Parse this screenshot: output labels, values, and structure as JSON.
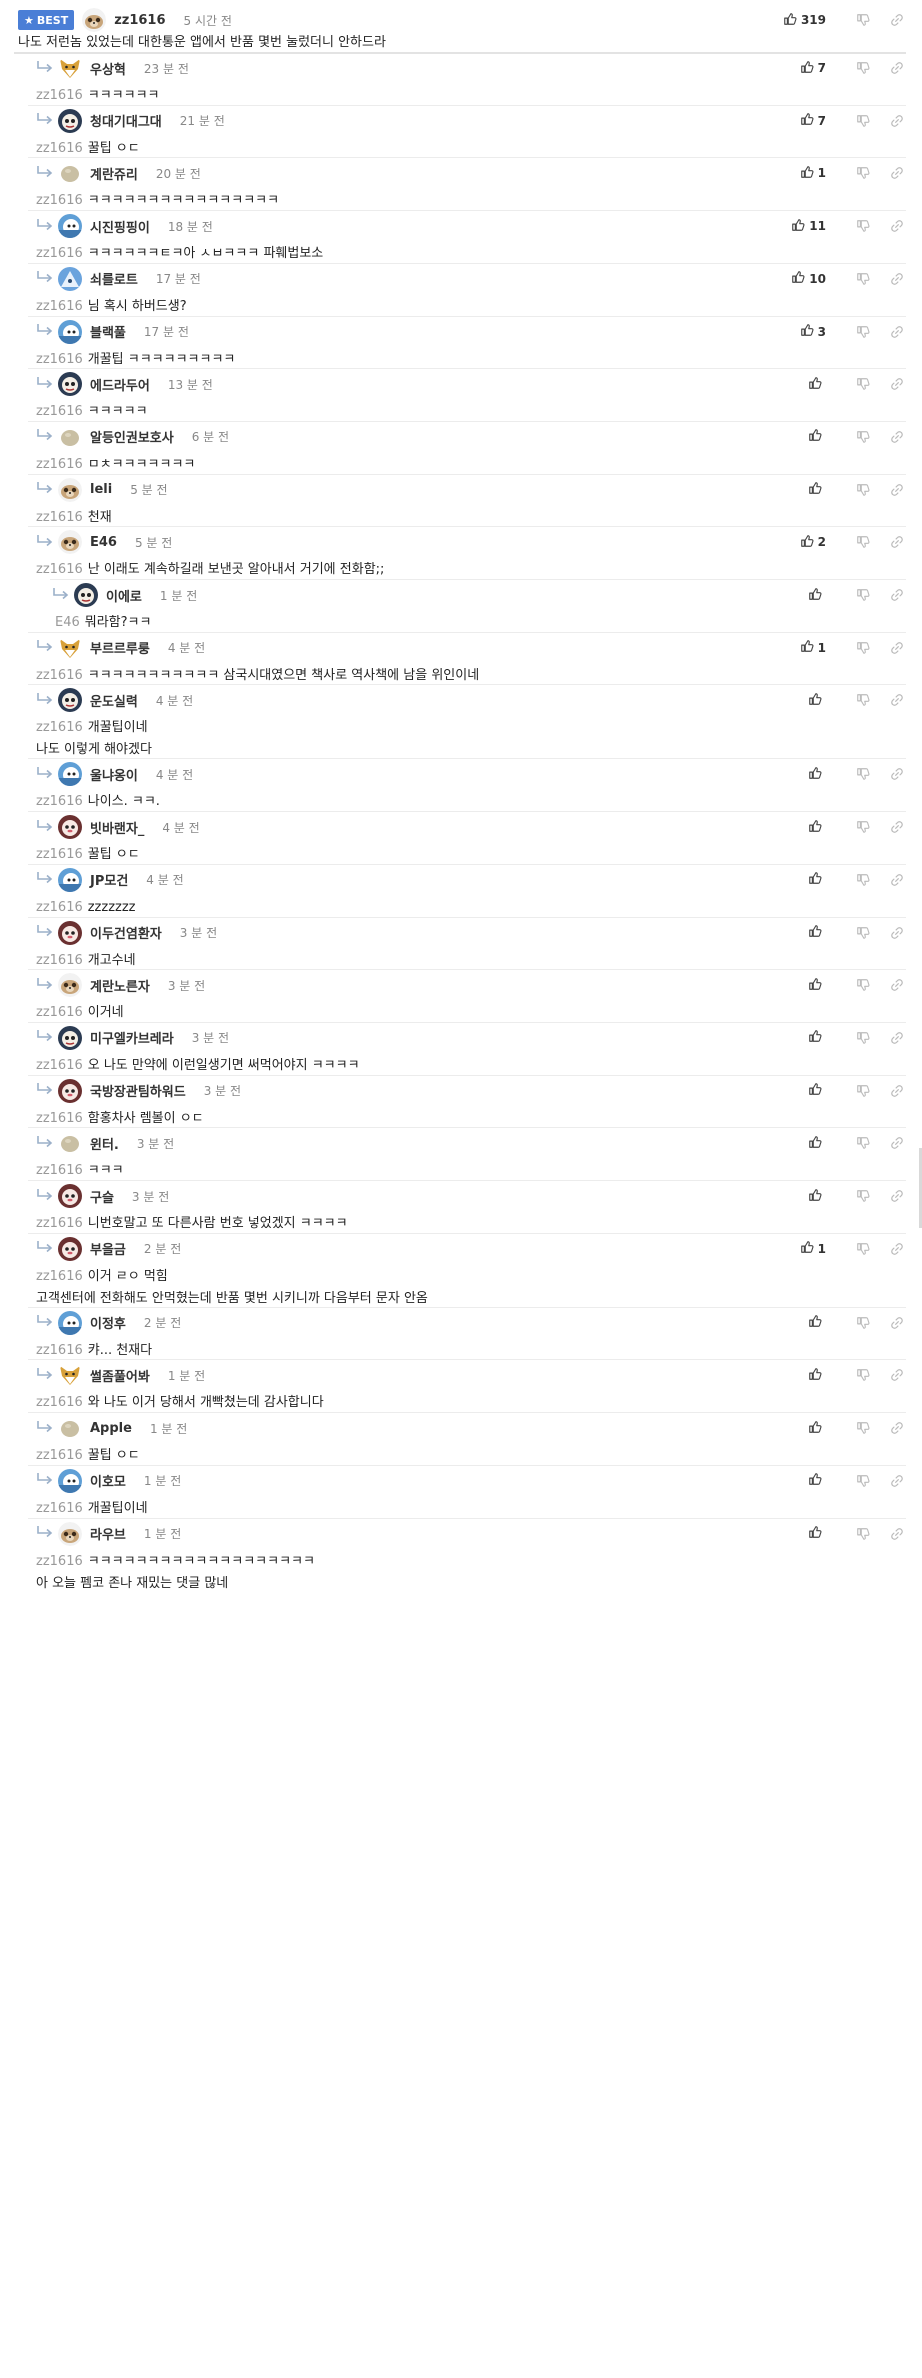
{
  "best_badge": "BEST",
  "comments": [
    {
      "nick": "zz1616",
      "time": "5 시간 전",
      "likes": "319",
      "mention": "",
      "lines": [
        "나도 저런놈 있었는데 대한통운 앱에서 반품 몇번 눌렀더니 안하드라"
      ],
      "avatar": "meerkat",
      "best": true
    },
    {
      "nick": "우상혁",
      "time": "23 분 전",
      "likes": "7",
      "mention": "zz1616",
      "lines": [
        "ㅋㅋㅋㅋㅋㅋ"
      ],
      "avatar": "fox"
    },
    {
      "nick": "청대기대그대",
      "time": "21 분 전",
      "likes": "7",
      "mention": "zz1616",
      "lines": [
        "꿀팁 ㅇㄷ"
      ],
      "avatar": "dark"
    },
    {
      "nick": "계란쥬리",
      "time": "20 분 전",
      "likes": "1",
      "mention": "zz1616",
      "lines": [
        "ㅋㅋㅋㅋㅋㅋㅋㅋㅋㅋㅋㅋㅋㅋㅋㅋ"
      ],
      "avatar": "egg"
    },
    {
      "nick": "시진핑핑이",
      "time": "18 분 전",
      "likes": "11",
      "mention": "zz1616",
      "lines": [
        "ㅋㅋㅋㅋㅋㅋㅌㅋ아 ㅅㅂㅋㅋㅋ 파훼법보소"
      ],
      "avatar": "blue"
    },
    {
      "nick": "쇠를로트",
      "time": "17 분 전",
      "likes": "10",
      "mention": "zz1616",
      "lines": [
        "님 혹시 하버드생?"
      ],
      "avatar": "blue2"
    },
    {
      "nick": "블랙풀",
      "time": "17 분 전",
      "likes": "3",
      "mention": "zz1616",
      "lines": [
        "개꿀팁 ㅋㅋㅋㅋㅋㅋㅋㅋㅋ"
      ],
      "avatar": "blue"
    },
    {
      "nick": "에드라두어",
      "time": "13 분 전",
      "likes": "",
      "mention": "zz1616",
      "lines": [
        "ㅋㅋㅋㅋㅋ"
      ],
      "avatar": "dark"
    },
    {
      "nick": "알등인권보호사",
      "time": "6 분 전",
      "likes": "",
      "mention": "zz1616",
      "lines": [
        "ㅁㅊㅋㅋㅋㅋㅋㅋㅋ"
      ],
      "avatar": "egg"
    },
    {
      "nick": "leli",
      "time": "5 분 전",
      "likes": "",
      "mention": "zz1616",
      "lines": [
        "천재"
      ],
      "avatar": "meerkat"
    },
    {
      "nick": "E46",
      "time": "5 분 전",
      "likes": "2",
      "mention": "zz1616",
      "lines": [
        "난 이래도 계속하길래 보낸곳 알아내서 거기에 전화함;;"
      ],
      "avatar": "meerkat"
    },
    {
      "nick": "이에로",
      "time": "1 분 전",
      "likes": "",
      "mention": "E46",
      "lines": [
        "뭐라함?ㅋㅋ"
      ],
      "avatar": "dark",
      "nested": true
    },
    {
      "nick": "부르르루룽",
      "time": "4 분 전",
      "likes": "1",
      "mention": "zz1616",
      "lines": [
        "ㅋㅋㅋㅋㅋㅋㅋㅋㅋㅋㅋ 삼국시대였으면 책사로 역사책에 남을 위인이네"
      ],
      "avatar": "fox"
    },
    {
      "nick": "운도실력",
      "time": "4 분 전",
      "likes": "",
      "mention": "zz1616",
      "lines": [
        "개꿀팁이네",
        "나도 이렇게 해야겠다"
      ],
      "avatar": "dark"
    },
    {
      "nick": "울냐옹이",
      "time": "4 분 전",
      "likes": "",
      "mention": "zz1616",
      "lines": [
        "나이스. ㅋㅋ."
      ],
      "avatar": "blue"
    },
    {
      "nick": "빗바랜자_",
      "time": "4 분 전",
      "likes": "",
      "mention": "zz1616",
      "lines": [
        "꿀팁 ㅇㄷ"
      ],
      "avatar": "pink"
    },
    {
      "nick": "JP모건",
      "time": "4 분 전",
      "likes": "",
      "mention": "zz1616",
      "lines": [
        "zzzzzzz"
      ],
      "avatar": "blue"
    },
    {
      "nick": "이두건염환자",
      "time": "3 분 전",
      "likes": "",
      "mention": "zz1616",
      "lines": [
        "개고수네"
      ],
      "avatar": "pink"
    },
    {
      "nick": "계란노른자",
      "time": "3 분 전",
      "likes": "",
      "mention": "zz1616",
      "lines": [
        "이거네"
      ],
      "avatar": "meerkat"
    },
    {
      "nick": "미구엘카브레라",
      "time": "3 분 전",
      "likes": "",
      "mention": "zz1616",
      "lines": [
        "오 나도 만약에 이런일생기면 써먹어야지 ㅋㅋㅋㅋ"
      ],
      "avatar": "dark"
    },
    {
      "nick": "국방장관팀하워드",
      "time": "3 분 전",
      "likes": "",
      "mention": "zz1616",
      "lines": [
        "함홍차사 렘볼이 ㅇㄷ"
      ],
      "avatar": "pink"
    },
    {
      "nick": "윈터.",
      "time": "3 분 전",
      "likes": "",
      "mention": "zz1616",
      "lines": [
        "ㅋㅋㅋ"
      ],
      "avatar": "egg"
    },
    {
      "nick": "구슬",
      "time": "3 분 전",
      "likes": "",
      "mention": "zz1616",
      "lines": [
        "니번호말고 또 다른사람 번호 넣었겠지 ㅋㅋㅋㅋ"
      ],
      "avatar": "pink"
    },
    {
      "nick": "부을금",
      "time": "2 분 전",
      "likes": "1",
      "mention": "zz1616",
      "lines": [
        "이거 ㄹㅇ 먹힘",
        "고객센터에 전화해도 안먹혔는데 반품 몇번 시키니까 다음부터 문자 안옴"
      ],
      "avatar": "pink"
    },
    {
      "nick": "이정후",
      "time": "2 분 전",
      "likes": "",
      "mention": "zz1616",
      "lines": [
        "캬... 천재다"
      ],
      "avatar": "blue"
    },
    {
      "nick": "썰좀풀어봐",
      "time": "1 분 전",
      "likes": "",
      "mention": "zz1616",
      "lines": [
        "와 나도 이거 당해서 개빡쳤는데 감사합니다"
      ],
      "avatar": "fox"
    },
    {
      "nick": "Apple",
      "time": "1 분 전",
      "likes": "",
      "mention": "zz1616",
      "lines": [
        "꿀팁 ㅇㄷ"
      ],
      "avatar": "egg"
    },
    {
      "nick": "이호모",
      "time": "1 분 전",
      "likes": "",
      "mention": "zz1616",
      "lines": [
        "개꿀팁이네"
      ],
      "avatar": "blue"
    },
    {
      "nick": "라우브",
      "time": "1 분 전",
      "likes": "",
      "mention": "zz1616",
      "lines": [
        "ㅋㅋㅋㅋㅋㅋㅋㅋㅋㅋㅋㅋㅋㅋㅋㅋㅋㅋㅋ",
        "아 오늘 펨코 존나 재밌는 댓글 많네"
      ],
      "avatar": "meerkat"
    }
  ],
  "icons": {
    "like": "thumbs-up-icon",
    "dislike": "thumbs-down-icon",
    "link": "link-icon",
    "reply": "reply-arrow-icon",
    "star": "star-icon"
  },
  "colors": {
    "badge": "#4a7ed6",
    "mention": "#999999",
    "time": "#888888",
    "separator": "#ececec"
  }
}
